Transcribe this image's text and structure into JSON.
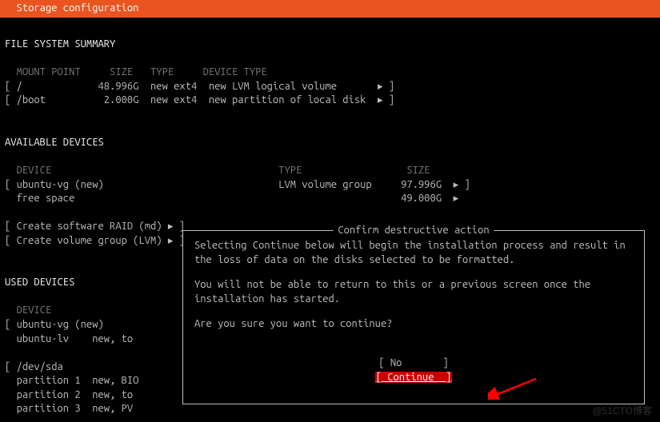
{
  "header": {
    "title": "  Storage configuration"
  },
  "sections": {
    "file_system_summary": {
      "title": "FILE SYSTEM SUMMARY",
      "columns": {
        "mount": "MOUNT POINT",
        "size": "SIZE",
        "type": "TYPE",
        "device_type": "DEVICE TYPE"
      },
      "rows": [
        {
          "mount": "/",
          "size": "48.996G",
          "type": "new ext4",
          "device_type": "new LVM logical volume",
          "arrow": "▸"
        },
        {
          "mount": "/boot",
          "size": "2.000G",
          "type": "new ext4",
          "device_type": "new partition of local disk",
          "arrow": "▸"
        }
      ]
    },
    "available_devices": {
      "title": "AVAILABLE DEVICES",
      "columns": {
        "device": "DEVICE",
        "type": "TYPE",
        "size": "SIZE"
      },
      "rows": [
        {
          "device": "ubuntu-vg (new)",
          "type": "LVM volume group",
          "size": "97.996G",
          "arrow": "▸"
        },
        {
          "device": "free space",
          "type": "",
          "size": "49.000G",
          "arrow": "▸",
          "indent": true
        }
      ],
      "actions": [
        {
          "label": "Create software RAID (md)",
          "arrow": "▸"
        },
        {
          "label": "Create volume group (LVM)",
          "arrow": "▸"
        }
      ]
    },
    "used_devices": {
      "title": "USED DEVICES",
      "columns": {
        "device": "DEVICE"
      },
      "groups": [
        {
          "device": "ubuntu-vg (new)",
          "children": [
            {
              "name": "ubuntu-lv",
              "detail": "new, to"
            }
          ]
        },
        {
          "device": "/dev/sda",
          "children": [
            {
              "name": "partition 1",
              "detail": "new, BIO"
            },
            {
              "name": "partition 2",
              "detail": "new, to"
            },
            {
              "name": "partition 3",
              "detail": "new, PV"
            }
          ]
        }
      ]
    }
  },
  "dialog": {
    "title": "Confirm destructive action",
    "para1": "Selecting Continue below will begin the installation process and result in the loss of data on the disks selected to be formatted.",
    "para2": "You will not be able to return to this or a previous screen once the installation has started.",
    "para3": "Are you sure you want to continue?",
    "btn_no": "No",
    "btn_continue": "Continue"
  },
  "watermark": "@51CTO博客"
}
